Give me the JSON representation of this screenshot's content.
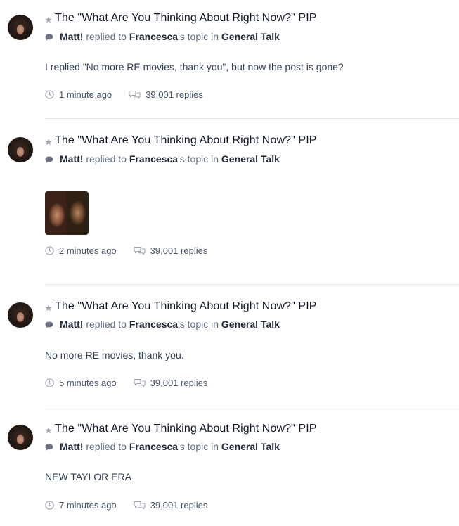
{
  "feed": {
    "items": [
      {
        "title": "The \"What Are You Thinking About Right Now?\" PIP",
        "author": "Matt!",
        "action_text": "replied to",
        "topic_owner": "Francesca",
        "topic_suffix": "'s topic in",
        "forum": "General Talk",
        "content": "I replied \"No more RE movies, thank you\", but now the post is gone?",
        "time_ago": "1 minute ago",
        "replies": "39,001 replies"
      },
      {
        "title": "The \"What Are You Thinking About Right Now?\" PIP",
        "author": "Matt!",
        "action_text": "replied to",
        "topic_owner": "Francesca",
        "topic_suffix": "'s topic in",
        "forum": "General Talk",
        "content": "",
        "time_ago": "2 minutes ago",
        "replies": "39,001 replies"
      },
      {
        "title": "The \"What Are You Thinking About Right Now?\" PIP",
        "author": "Matt!",
        "action_text": "replied to",
        "topic_owner": "Francesca",
        "topic_suffix": "'s topic in",
        "forum": "General Talk",
        "content": "No more RE movies, thank you.",
        "time_ago": "5 minutes ago",
        "replies": "39,001 replies"
      },
      {
        "title": "The \"What Are You Thinking About Right Now?\" PIP",
        "author": "Matt!",
        "action_text": "replied to",
        "topic_owner": "Francesca",
        "topic_suffix": "'s topic in",
        "forum": "General Talk",
        "content": "NEW TAYLOR ERA",
        "time_ago": "7 minutes ago",
        "replies": "39,001 replies"
      }
    ]
  },
  "icons": {
    "star": "star-icon",
    "bubble": "chat-bubble-icon",
    "clock": "clock-icon",
    "replies": "comments-icon"
  },
  "colors": {
    "title": "#111827",
    "meta": "#5d6b82",
    "icon": "#9ca3af",
    "divider": "#e5e7eb"
  }
}
